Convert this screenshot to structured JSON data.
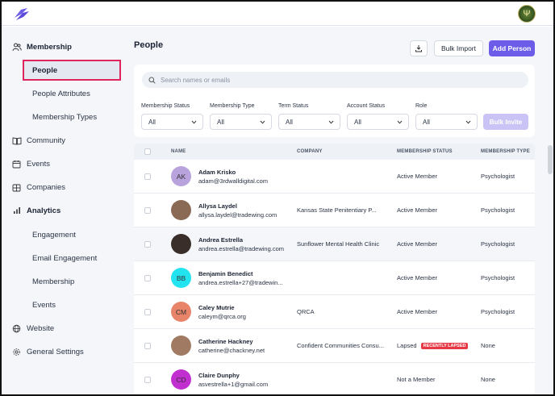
{
  "sidebar": {
    "sections": [
      {
        "label": "Membership",
        "icon": "users-icon"
      },
      {
        "label": "Community",
        "icon": "book-icon"
      },
      {
        "label": "Events",
        "icon": "calendar-icon"
      },
      {
        "label": "Companies",
        "icon": "building-icon"
      },
      {
        "label": "Analytics",
        "icon": "bar-chart-icon"
      },
      {
        "label": "Website",
        "icon": "globe-icon"
      },
      {
        "label": "General Settings",
        "icon": "gear-icon"
      }
    ],
    "membership_items": [
      "People",
      "People Attributes",
      "Membership Types"
    ],
    "analytics_items": [
      "Engagement",
      "Email Engagement",
      "Membership",
      "Events"
    ]
  },
  "page": {
    "title": "People",
    "bulk_import": "Bulk Import",
    "add_person": "Add Person",
    "bulk_invite": "Bulk Invite"
  },
  "search": {
    "placeholder": "Search names or emails"
  },
  "filters": [
    {
      "label": "Membership Status",
      "value": "All"
    },
    {
      "label": "Membership Type",
      "value": "All"
    },
    {
      "label": "Term Status",
      "value": "All"
    },
    {
      "label": "Account Status",
      "value": "All"
    },
    {
      "label": "Role",
      "value": "All"
    }
  ],
  "table": {
    "columns": [
      "NAME",
      "COMPANY",
      "MEMBERSHIP STATUS",
      "MEMBERSHIP TYPE"
    ],
    "rows": [
      {
        "initials": "AK",
        "avatar_color": "#b9a3dd",
        "name": "Adam Krisko",
        "email": "adam@3rdwalldigital.com",
        "company": "",
        "status": "Active Member",
        "badge": "",
        "type": "Psychologist"
      },
      {
        "initials": "",
        "avatar_color": "#8a6a55",
        "name": "Allysa Laydel",
        "email": "allysa.laydel@tradewing.com",
        "company": "Kansas State Penitentiary P...",
        "status": "Active Member",
        "badge": "",
        "type": "Psychologist"
      },
      {
        "initials": "",
        "avatar_color": "#3a2e2a",
        "name": "Andrea Estrella",
        "email": "andrea.estrella@tradewing.com",
        "company": "Sunflower Mental Health Clinic",
        "status": "Active Member",
        "badge": "",
        "type": "Psychologist"
      },
      {
        "initials": "BB",
        "avatar_color": "#22e3f0",
        "name": "Benjamin Benedict",
        "email": "andrea.estrella+27@tradewin...",
        "company": "",
        "status": "Active Member",
        "badge": "",
        "type": "Psychologist"
      },
      {
        "initials": "CM",
        "avatar_color": "#e8846a",
        "name": "Caley Mutrie",
        "email": "caleym@qrca.org",
        "company": "QRCA",
        "status": "Active Member",
        "badge": "",
        "type": "Psychologist"
      },
      {
        "initials": "",
        "avatar_color": "#a07a62",
        "name": "Catherine Hackney",
        "email": "catherine@chackney.net",
        "company": "Confident Communities Consu...",
        "status": "Lapsed",
        "badge": "RECENTLY LAPSED",
        "type": "None"
      },
      {
        "initials": "CD",
        "avatar_color": "#c22fd0",
        "name": "Claire Dunphy",
        "email": "asvestrella+1@gmail.com",
        "company": "",
        "status": "Not a Member",
        "badge": "",
        "type": "None"
      }
    ]
  },
  "colors": {
    "accent": "#6c5ce7",
    "highlight_border": "#e0245e",
    "badge": "#e53945"
  }
}
